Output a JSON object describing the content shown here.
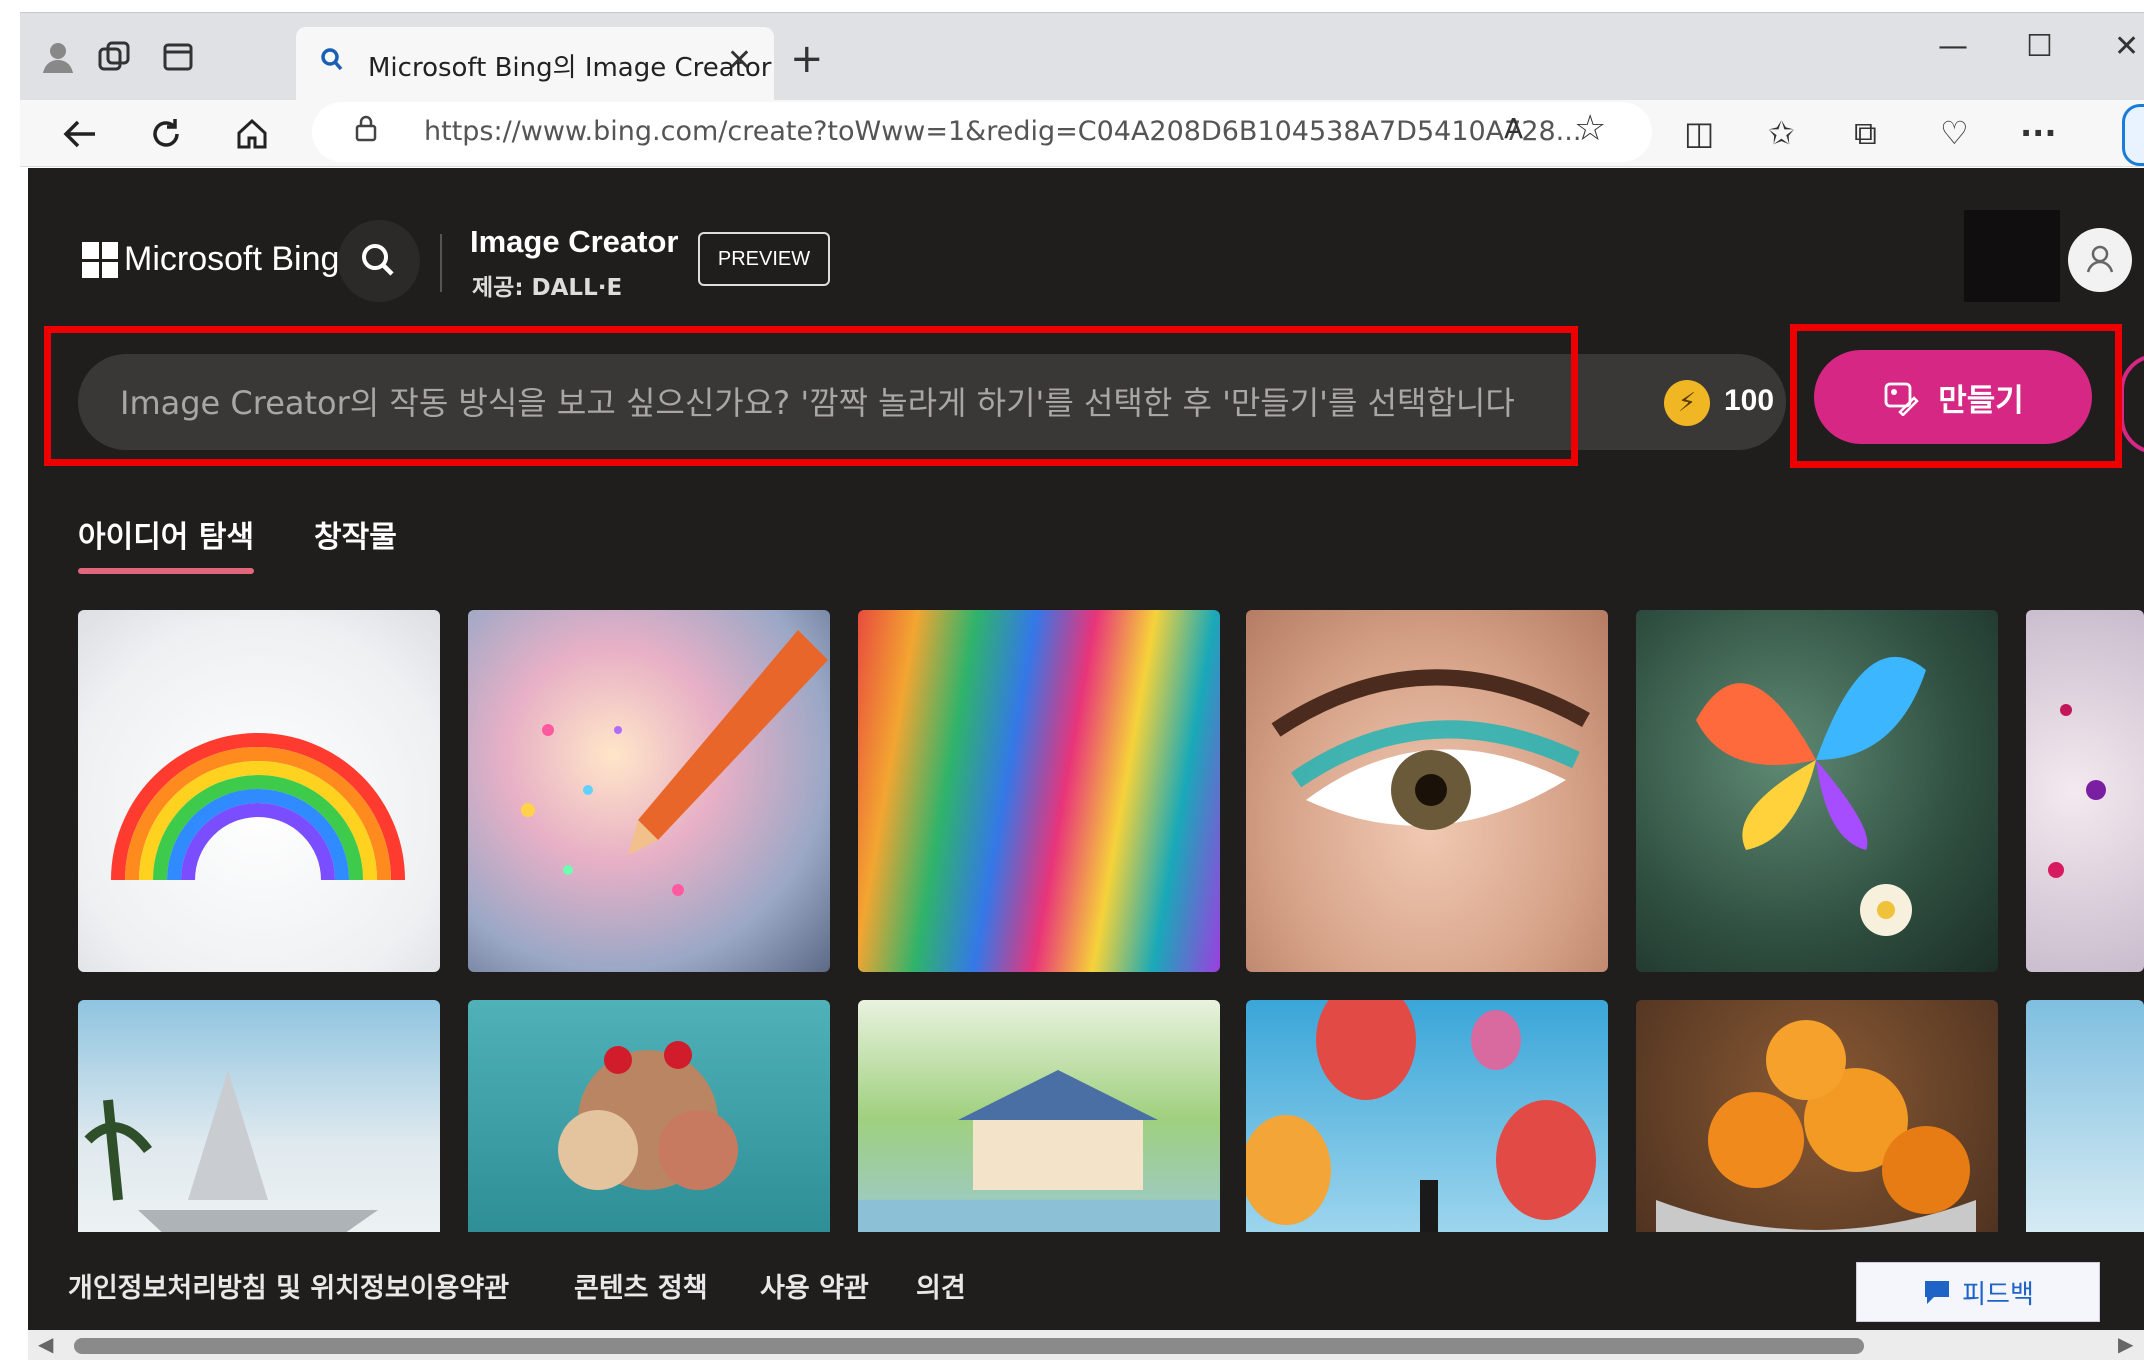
{
  "browser": {
    "tab_title": "Microsoft Bing의 Image Creator",
    "tab_close": "✕",
    "new_tab": "+",
    "url": "https://www.bing.com/create?toWww=1&redig=C04A208D6B104538A7D5410A728...",
    "read_aloud": "A",
    "window_controls": {
      "minimize": "—",
      "maximize": "☐",
      "close": "✕"
    },
    "more_menu": "···"
  },
  "header": {
    "brand": "Microsoft Bing",
    "product_title": "Image Creator",
    "product_subtitle": "제공: DALL·E",
    "preview_badge": "PREVIEW"
  },
  "prompt": {
    "placeholder": "Image Creator의 작동 방식을 보고 싶으신가요? '깜짝 놀라게 하기'를 선택한 후 '만들기'를 선택합니다",
    "boost_count": "100",
    "create_label": "만들기"
  },
  "tabs": [
    {
      "label": "아이디어 탐색",
      "active": true
    },
    {
      "label": "창작물",
      "active": false
    }
  ],
  "gallery": {
    "tiles": [
      {
        "name": "rainbow-image"
      },
      {
        "name": "glitter-pencil-image"
      },
      {
        "name": "ribbons-image"
      },
      {
        "name": "eye-makeup-image"
      },
      {
        "name": "butterfly-image"
      },
      {
        "name": "paint-splash-image"
      },
      {
        "name": "paper-boat-image"
      },
      {
        "name": "ice-cream-image"
      },
      {
        "name": "lake-house-image"
      },
      {
        "name": "balloons-image"
      },
      {
        "name": "oranges-image"
      },
      {
        "name": "beach-image"
      }
    ]
  },
  "footer": {
    "links": [
      "개인정보처리방침 및 위치정보이용약관",
      "콘텐츠 정책",
      "사용 약관",
      "의견"
    ],
    "feedback_label": "피드백"
  },
  "colors": {
    "page_bg": "#201d1d",
    "create_button": "#d62784",
    "highlight": "#ee0000",
    "tab_underline": "#e2677a"
  }
}
